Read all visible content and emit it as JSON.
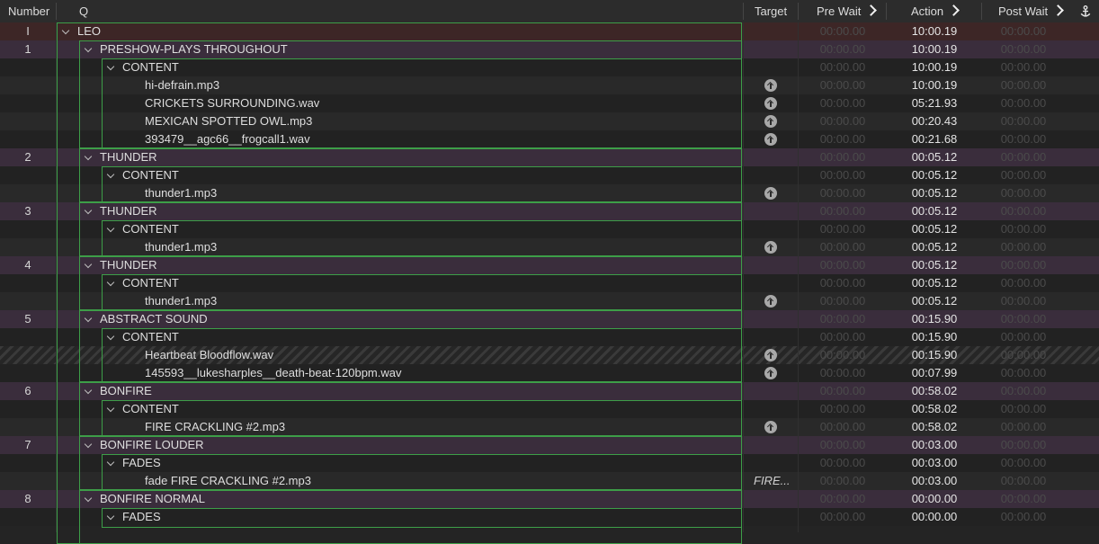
{
  "header": {
    "number": "Number",
    "q": "Q",
    "target": "Target",
    "pre_wait": "Pre Wait",
    "action": "Action",
    "post_wait": "Post Wait",
    "anchor_icon": "anchor-icon"
  },
  "colors": {
    "accent_green": "#3d9e48",
    "group_row": "#3a2d3c",
    "top_row": "#3d2626"
  },
  "rows": [
    {
      "num": "I",
      "name": "LEO",
      "level": 0,
      "type": "top",
      "disclosure": true,
      "target": "",
      "pre": "00:00.00",
      "action": "10:00.19",
      "post": "00:00.00"
    },
    {
      "num": "1",
      "name": "PRESHOW-PLAYS THROUGHOUT",
      "level": 1,
      "type": "group",
      "disclosure": true,
      "target": "",
      "pre": "00:00.00",
      "action": "10:00.19",
      "post": "00:00.00"
    },
    {
      "num": "",
      "name": "CONTENT",
      "level": 2,
      "type": "dark",
      "disclosure": true,
      "target": "",
      "pre": "00:00.00",
      "action": "10:00.19",
      "post": "00:00.00"
    },
    {
      "num": "",
      "name": "hi-defrain.mp3",
      "level": 3,
      "type": "alt",
      "disclosure": false,
      "target": "icon",
      "pre": "00:00.00",
      "action": "10:00.19",
      "post": "00:00.00"
    },
    {
      "num": "",
      "name": "CRICKETS SURROUNDING.wav",
      "level": 3,
      "type": "dark",
      "disclosure": false,
      "target": "icon",
      "pre": "00:00.00",
      "action": "05:21.93",
      "post": "00:00.00"
    },
    {
      "num": "",
      "name": "MEXICAN SPOTTED OWL.mp3",
      "level": 3,
      "type": "alt",
      "disclosure": false,
      "target": "icon",
      "pre": "00:00.00",
      "action": "00:20.43",
      "post": "00:00.00"
    },
    {
      "num": "",
      "name": "393479__agc66__frogcall1.wav",
      "level": 3,
      "type": "dark",
      "disclosure": false,
      "target": "icon",
      "pre": "00:00.00",
      "action": "00:21.68",
      "post": "00:00.00"
    },
    {
      "num": "2",
      "name": "THUNDER",
      "level": 1,
      "type": "group",
      "disclosure": true,
      "target": "",
      "pre": "00:00.00",
      "action": "00:05.12",
      "post": "00:00.00"
    },
    {
      "num": "",
      "name": "CONTENT",
      "level": 2,
      "type": "dark",
      "disclosure": true,
      "target": "",
      "pre": "00:00.00",
      "action": "00:05.12",
      "post": "00:00.00"
    },
    {
      "num": "",
      "name": "thunder1.mp3",
      "level": 3,
      "type": "alt",
      "disclosure": false,
      "target": "icon",
      "pre": "00:00.00",
      "action": "00:05.12",
      "post": "00:00.00"
    },
    {
      "num": "3",
      "name": "THUNDER",
      "level": 1,
      "type": "group",
      "disclosure": true,
      "target": "",
      "pre": "00:00.00",
      "action": "00:05.12",
      "post": "00:00.00"
    },
    {
      "num": "",
      "name": "CONTENT",
      "level": 2,
      "type": "dark",
      "disclosure": true,
      "target": "",
      "pre": "00:00.00",
      "action": "00:05.12",
      "post": "00:00.00"
    },
    {
      "num": "",
      "name": "thunder1.mp3",
      "level": 3,
      "type": "alt",
      "disclosure": false,
      "target": "icon",
      "pre": "00:00.00",
      "action": "00:05.12",
      "post": "00:00.00"
    },
    {
      "num": "4",
      "name": "THUNDER",
      "level": 1,
      "type": "group",
      "disclosure": true,
      "target": "",
      "pre": "00:00.00",
      "action": "00:05.12",
      "post": "00:00.00"
    },
    {
      "num": "",
      "name": "CONTENT",
      "level": 2,
      "type": "dark",
      "disclosure": true,
      "target": "",
      "pre": "00:00.00",
      "action": "00:05.12",
      "post": "00:00.00"
    },
    {
      "num": "",
      "name": "thunder1.mp3",
      "level": 3,
      "type": "alt",
      "disclosure": false,
      "target": "icon",
      "pre": "00:00.00",
      "action": "00:05.12",
      "post": "00:00.00"
    },
    {
      "num": "5",
      "name": "ABSTRACT SOUND",
      "level": 1,
      "type": "group",
      "disclosure": true,
      "target": "",
      "pre": "00:00.00",
      "action": "00:15.90",
      "post": "00:00.00"
    },
    {
      "num": "",
      "name": "CONTENT",
      "level": 2,
      "type": "dark",
      "disclosure": true,
      "target": "",
      "pre": "00:00.00",
      "action": "00:15.90",
      "post": "00:00.00"
    },
    {
      "num": "",
      "name": "Heartbeat Bloodflow.wav",
      "level": 3,
      "type": "hatch",
      "disclosure": false,
      "target": "icon",
      "pre": "00:00.00",
      "action": "00:15.90",
      "post": "00:00.00"
    },
    {
      "num": "",
      "name": "145593__lukesharples__death-beat-120bpm.wav",
      "level": 3,
      "type": "dark",
      "disclosure": false,
      "target": "icon",
      "pre": "00:00.00",
      "action": "00:07.99",
      "post": "00:00.00"
    },
    {
      "num": "6",
      "name": "BONFIRE",
      "level": 1,
      "type": "group",
      "disclosure": true,
      "target": "",
      "pre": "00:00.00",
      "action": "00:58.02",
      "post": "00:00.00"
    },
    {
      "num": "",
      "name": "CONTENT",
      "level": 2,
      "type": "dark",
      "disclosure": true,
      "target": "",
      "pre": "00:00.00",
      "action": "00:58.02",
      "post": "00:00.00"
    },
    {
      "num": "",
      "name": "FIRE CRACKLING #2.mp3",
      "level": 3,
      "type": "alt",
      "disclosure": false,
      "target": "icon",
      "pre": "00:00.00",
      "action": "00:58.02",
      "post": "00:00.00"
    },
    {
      "num": "7",
      "name": "BONFIRE LOUDER",
      "level": 1,
      "type": "group",
      "disclosure": true,
      "target": "",
      "pre": "00:00.00",
      "action": "00:03.00",
      "post": "00:00.00"
    },
    {
      "num": "",
      "name": "FADES",
      "level": 2,
      "type": "dark",
      "disclosure": true,
      "target": "",
      "pre": "00:00.00",
      "action": "00:03.00",
      "post": "00:00.00"
    },
    {
      "num": "",
      "name": "fade FIRE CRACKLING #2.mp3",
      "level": 3,
      "type": "alt",
      "disclosure": false,
      "target": "FIRE...",
      "pre": "00:00.00",
      "action": "00:03.00",
      "post": "00:00.00"
    },
    {
      "num": "8",
      "name": "BONFIRE NORMAL",
      "level": 1,
      "type": "group",
      "disclosure": true,
      "target": "",
      "pre": "00:00.00",
      "action": "00:00.00",
      "post": "00:00.00"
    },
    {
      "num": "",
      "name": "FADES",
      "level": 2,
      "type": "dark",
      "disclosure": true,
      "target": "",
      "pre": "00:00.00",
      "action": "00:00.00",
      "post": "00:00.00"
    }
  ]
}
